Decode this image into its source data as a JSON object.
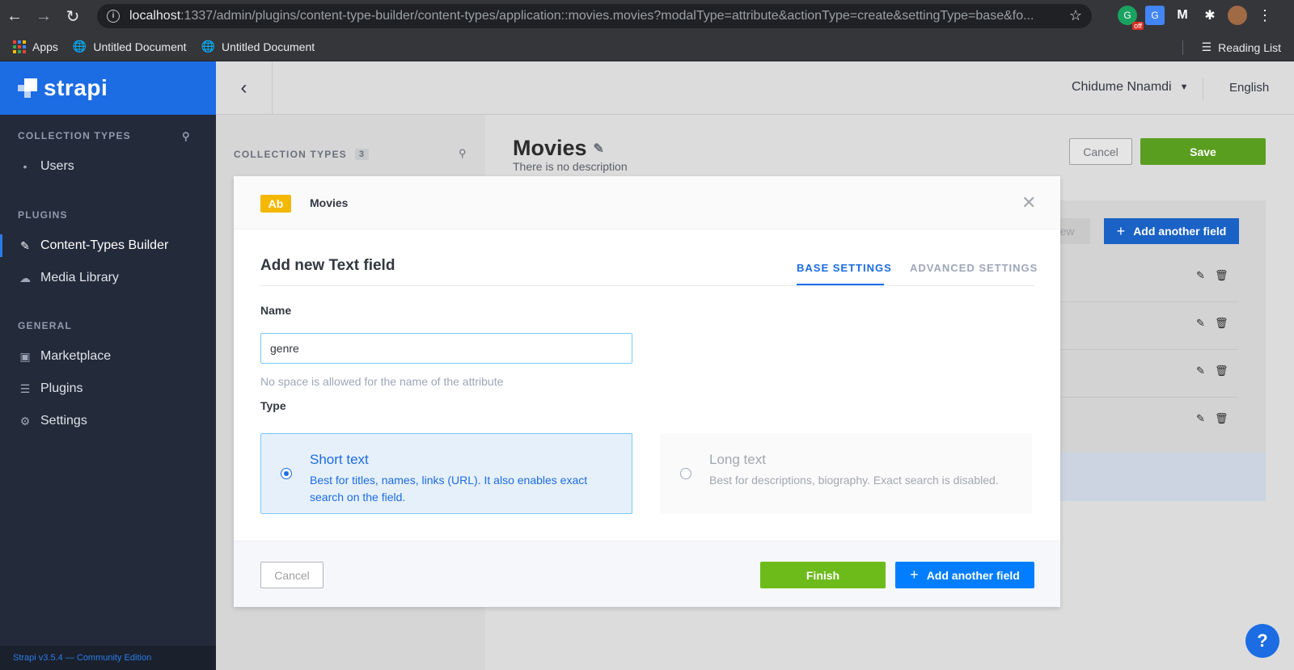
{
  "browser": {
    "url_host": "localhost",
    "url_rest": ":1337/admin/plugins/content-type-builder/content-types/application::movies.movies?modalType=attribute&actionType=create&settingType=base&fo...",
    "extension_badge": "off",
    "bookmarks": [
      {
        "label": "Apps"
      },
      {
        "label": "Untitled Document"
      },
      {
        "label": "Untitled Document"
      }
    ],
    "reading_list": "Reading List"
  },
  "sidebar": {
    "brand": "strapi",
    "collection_types_heading": "COLLECTION TYPES",
    "collection_items": [
      {
        "label": "Users"
      }
    ],
    "plugins_heading": "PLUGINS",
    "plugins": [
      {
        "label": "Content-Types Builder",
        "active": true
      },
      {
        "label": "Media Library"
      }
    ],
    "general_heading": "GENERAL",
    "general": [
      {
        "label": "Marketplace"
      },
      {
        "label": "Plugins"
      },
      {
        "label": "Settings"
      }
    ],
    "footer": "Strapi v3.5.4 — Community Edition"
  },
  "header": {
    "user": "Chidume Nnamdi",
    "language": "English"
  },
  "ct_panel": {
    "title": "COLLECTION TYPES",
    "count": "3"
  },
  "main": {
    "title": "Movies",
    "description": "There is no description",
    "cancel": "Cancel",
    "save": "Save",
    "view_partial": "iew",
    "add_another_field": "Add another field"
  },
  "modal": {
    "badge": "Ab",
    "breadcrumb": "Movies",
    "title": "Add new Text field",
    "tab_base": "BASE SETTINGS",
    "tab_advanced": "ADVANCED SETTINGS",
    "name_label": "Name",
    "name_value": "genre",
    "name_hint": "No space is allowed for the name of the attribute",
    "type_label": "Type",
    "short_text": {
      "name": "Short text",
      "description": "Best for titles, names, links (URL). It also enables exact search on the field."
    },
    "long_text": {
      "name": "Long text",
      "description": "Best for descriptions, biography. Exact search is disabled."
    },
    "cancel": "Cancel",
    "finish": "Finish",
    "add_another_field": "Add another field"
  },
  "help": "?"
}
